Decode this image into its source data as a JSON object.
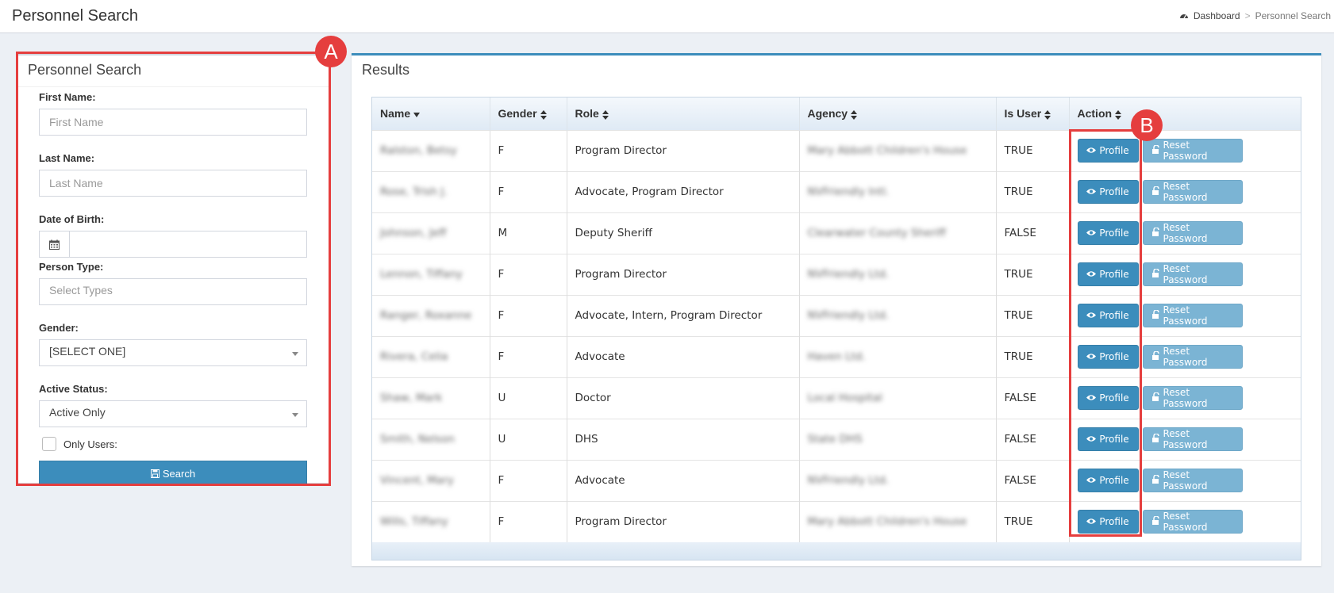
{
  "header": {
    "title": "Personnel Search",
    "breadcrumb": {
      "home": "Dashboard",
      "separator": ">",
      "current": "Personnel Search"
    }
  },
  "search_panel": {
    "title": "Personnel Search",
    "first_name": {
      "label": "First Name:",
      "placeholder": "First Name"
    },
    "last_name": {
      "label": "Last Name:",
      "placeholder": "Last Name"
    },
    "dob": {
      "label": "Date of Birth:",
      "icon": "calendar-icon"
    },
    "person_type": {
      "label": "Person Type:",
      "placeholder": "Select Types"
    },
    "gender": {
      "label": "Gender:",
      "value": "[SELECT ONE]"
    },
    "active_status": {
      "label": "Active Status:",
      "value": "Active Only"
    },
    "only_users": {
      "label": "Only Users:",
      "checked": false
    },
    "search_button": "Search"
  },
  "results": {
    "title": "Results",
    "columns": [
      "Name",
      "Gender",
      "Role",
      "Agency",
      "Is User",
      "Action"
    ],
    "profile_label": "Profile",
    "reset_label": "Reset Password",
    "rows": [
      {
        "name": "Ralston, Betsy",
        "gender": "F",
        "role": "Program Director",
        "agency": "Mary Abbott Children's House",
        "is_user": "TRUE"
      },
      {
        "name": "Rose, Trish J.",
        "gender": "F",
        "role": "Advocate, Program Director",
        "agency": "NVFriendly Intl.",
        "is_user": "TRUE"
      },
      {
        "name": "Johnson, Jeff",
        "gender": "M",
        "role": "Deputy Sheriff",
        "agency": "Clearwater County Sheriff",
        "is_user": "FALSE"
      },
      {
        "name": "Lennon, Tiffany",
        "gender": "F",
        "role": "Program Director",
        "agency": "NVFriendly Ltd.",
        "is_user": "TRUE"
      },
      {
        "name": "Ranger, Roxanne",
        "gender": "F",
        "role": "Advocate, Intern, Program Director",
        "agency": "NVFriendly Ltd.",
        "is_user": "TRUE"
      },
      {
        "name": "Rivera, Celia",
        "gender": "F",
        "role": "Advocate",
        "agency": "Haven Ltd.",
        "is_user": "TRUE"
      },
      {
        "name": "Shaw, Mark",
        "gender": "U",
        "role": "Doctor",
        "agency": "Local Hospital",
        "is_user": "FALSE"
      },
      {
        "name": "Smith, Nelson",
        "gender": "U",
        "role": "DHS",
        "agency": "State DHS",
        "is_user": "FALSE"
      },
      {
        "name": "Vincent, Mary",
        "gender": "F",
        "role": "Advocate",
        "agency": "NVFriendly Ltd.",
        "is_user": "FALSE"
      },
      {
        "name": "Wills, Tiffany",
        "gender": "F",
        "role": "Program Director",
        "agency": "Mary Abbott Children's House",
        "is_user": "TRUE"
      }
    ]
  },
  "annotations": {
    "a": "A",
    "b": "B"
  },
  "colors": {
    "primary": "#3c8dbc",
    "reset_button": "#7bb4d4",
    "callout": "#e53e3e",
    "background": "#ecf0f5"
  }
}
